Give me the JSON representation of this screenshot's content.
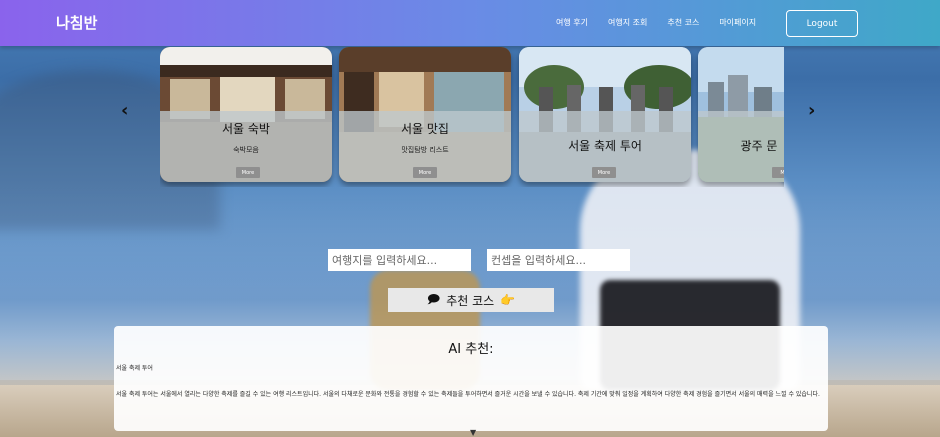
{
  "header": {
    "logo": "나침반",
    "nav": [
      "여행 후기",
      "여행지 조회",
      "추천 코스",
      "마이페이지"
    ],
    "logout": "Logout"
  },
  "carousel": {
    "prev_icon": "chevron-left",
    "next_icon": "chevron-right",
    "cards": [
      {
        "title": "서울 숙박",
        "subtitle": "숙박모음",
        "more": "More"
      },
      {
        "title": "서울 맛집",
        "subtitle": "맛집탐방 리스트",
        "more": "More"
      },
      {
        "title": "서울 축제 투어",
        "subtitle": "",
        "more": "More"
      },
      {
        "title": "광주 문",
        "subtitle": "",
        "more": "Mo"
      }
    ]
  },
  "form": {
    "destination_placeholder": "여행지를 입력하세요...",
    "concept_placeholder": "컨셉을 입력하세요...",
    "recommend_label": "추천 코스"
  },
  "ai": {
    "heading": "AI 추천:",
    "title": "서울 축제 투어",
    "body": "서울 축제 투어는 서울에서 열리는 다양한 축제를 즐길 수 있는 여행 리스트입니다. 서울의 다채로운 문화와 전통을 경험할 수 있는 축제들을 투어하면서 즐거운 시간을 보낼 수 있습니다. 축제 기간에 맞춰 일정을 계획하여 다양한 축제 경험을 즐기면서 서울의 매력을 느낄 수 있습니다."
  }
}
